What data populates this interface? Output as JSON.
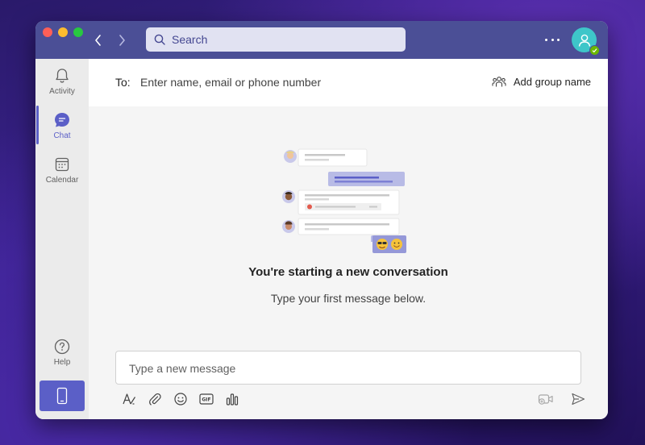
{
  "titlebar": {
    "search_placeholder": "Search",
    "more_icon": "more-horizontal-icon",
    "avatar_icon": "person-icon",
    "presence_status": "available",
    "colors": {
      "titlebar": "#4b4f96",
      "accent": "#5b5fc7",
      "avatar": "#3ec6c9",
      "presence": "#6bb700"
    }
  },
  "rail": {
    "items": [
      {
        "label": "Activity",
        "icon": "bell-icon"
      },
      {
        "label": "Chat",
        "icon": "chat-icon",
        "active": true
      },
      {
        "label": "Calendar",
        "icon": "calendar-icon"
      }
    ],
    "help_label": "Help",
    "mobile_icon": "phone-icon"
  },
  "recipient_bar": {
    "to_label": "To:",
    "input_placeholder": "Enter name, email or phone number",
    "add_group_label": "Add group name"
  },
  "empty_state": {
    "headline": "You're starting a new conversation",
    "subline": "Type your first message below."
  },
  "composer": {
    "placeholder": "Type a new message",
    "tools": [
      "format-icon",
      "attach-icon",
      "emoji-icon",
      "gif-icon",
      "poll-icon"
    ],
    "right_tools": [
      "meet-now-icon",
      "send-icon"
    ]
  }
}
